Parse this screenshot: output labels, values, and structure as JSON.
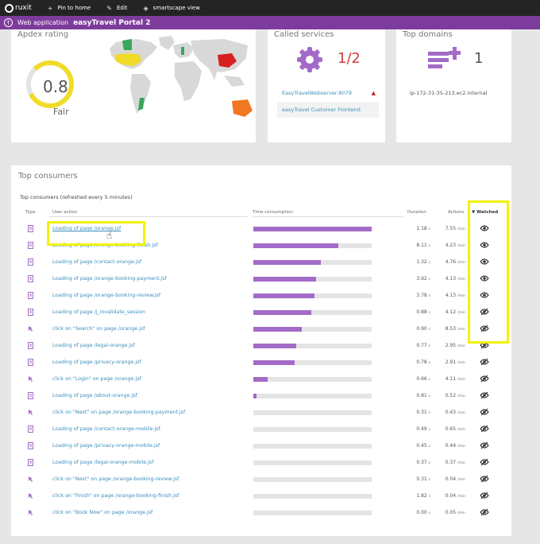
{
  "topbar": {
    "logo": "ruxit",
    "items": [
      {
        "icon": "+",
        "label": "Pin to home"
      },
      {
        "icon": "✎",
        "label": "Edit"
      },
      {
        "icon": "◈",
        "label": "smartscape view"
      }
    ]
  },
  "appbar": {
    "prefix": "Web application",
    "title": "easyTravel Portal 2"
  },
  "apdex": {
    "title": "Apdex rating",
    "value": "0.8",
    "label": "Fair",
    "fraction": 0.8,
    "color": "#f0dc28"
  },
  "called_services": {
    "title": "Called services",
    "count": "1/2",
    "rows": [
      "EasyTravelWebserver:8079",
      "easyTravel Customer Frontend"
    ]
  },
  "top_domains": {
    "title": "Top domains",
    "count": "1",
    "domain": "ip-172-31-35-213.ec2.internal"
  },
  "consumers": {
    "title": "Top consumers",
    "subtitle": "Top consumers (refreshed every 5 minutes)",
    "headers": {
      "type": "Type",
      "user_action": "User action",
      "time_consumption": "Time consumption",
      "duration": "Duration",
      "actions": "Actions",
      "watched": "▼ Watched"
    },
    "duration_unit": "s",
    "actions_unit": "/min",
    "rows": [
      {
        "kind": "page",
        "action": "Loading of page /orange.jsf",
        "time": 1.0,
        "duration": "1.18",
        "actions": "7.55",
        "watched": true
      },
      {
        "kind": "page",
        "action": "Loading of page /orange-booking-finish.jsf",
        "time": 0.72,
        "duration": "8.11",
        "actions": "4.23",
        "watched": true
      },
      {
        "kind": "page",
        "action": "Loading of page /contact-orange.jsf",
        "time": 0.57,
        "duration": "1.32",
        "actions": "4.76",
        "watched": true
      },
      {
        "kind": "page",
        "action": "Loading of page /orange-booking-payment.jsf",
        "time": 0.53,
        "duration": "3.92",
        "actions": "4.13",
        "watched": true
      },
      {
        "kind": "page",
        "action": "Loading of page /orange-booking-review.jsf",
        "time": 0.52,
        "duration": "3.78",
        "actions": "4.13",
        "watched": true
      },
      {
        "kind": "page",
        "action": "Loading of page /j_invalidate_session",
        "time": 0.49,
        "duration": "0.88",
        "actions": "4.12",
        "watched": false
      },
      {
        "kind": "click",
        "action": "click on \"Search\" on page /orange.jsf",
        "time": 0.41,
        "duration": "0.90",
        "actions": "8.53",
        "watched": false
      },
      {
        "kind": "page",
        "action": "Loading of page /legal-orange.jsf",
        "time": 0.36,
        "duration": "0.77",
        "actions": "2.95",
        "watched": false
      },
      {
        "kind": "page",
        "action": "Loading of page /privacy-orange.jsf",
        "time": 0.35,
        "duration": "0.78",
        "actions": "2.91",
        "watched": false
      },
      {
        "kind": "click",
        "action": "click on \"Login\" on page /orange.jsf",
        "time": 0.12,
        "duration": "0.66",
        "actions": "4.11",
        "watched": false
      },
      {
        "kind": "page",
        "action": "Loading of page /about-orange.jsf",
        "time": 0.03,
        "duration": "0.81",
        "actions": "0.52",
        "watched": false
      },
      {
        "kind": "click",
        "action": "click on \"Next\" on page /orange-booking-payment.jsf",
        "time": 0.0,
        "duration": "0.31",
        "actions": "0.43",
        "watched": false
      },
      {
        "kind": "page",
        "action": "Loading of page /contact-orange-mobile.jsf",
        "time": 0.0,
        "duration": "0.49",
        "actions": "0.65",
        "watched": false
      },
      {
        "kind": "page",
        "action": "Loading of page /privacy-orange-mobile.jsf",
        "time": 0.0,
        "duration": "0.45",
        "actions": "0.44",
        "watched": false
      },
      {
        "kind": "page",
        "action": "Loading of page /legal-orange-mobile.jsf",
        "time": 0.0,
        "duration": "0.37",
        "actions": "0.37",
        "watched": false
      },
      {
        "kind": "click",
        "action": "click on \"Next\" on page /orange-booking-review.jsf",
        "time": 0.0,
        "duration": "0.31",
        "actions": "0.04",
        "watched": false
      },
      {
        "kind": "click",
        "action": "click on \"Finish\" on page /orange-booking-finish.jsf",
        "time": 0.0,
        "duration": "1.82",
        "actions": "0.04",
        "watched": false
      },
      {
        "kind": "click",
        "action": "click on \"Book Now\" on page /orange.jsf",
        "time": 0.0,
        "duration": "0.00",
        "actions": "0.05",
        "watched": false
      }
    ]
  },
  "colors": {
    "purple": "#7d3c9b",
    "bar": "#a36bc7",
    "link": "#3a8fbd",
    "highlight": "#f2f20a"
  }
}
